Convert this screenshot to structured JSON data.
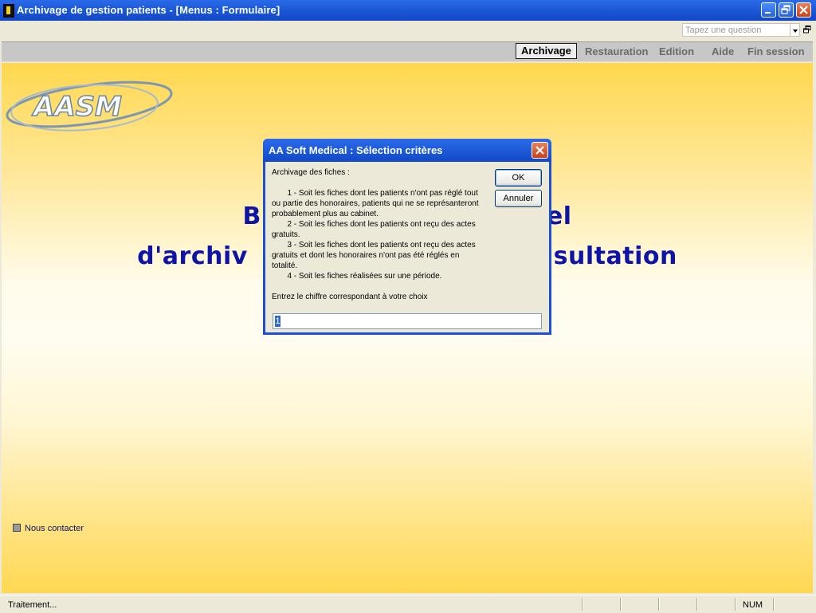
{
  "window": {
    "title": "Archivage de gestion patients - [Menus : Formulaire]"
  },
  "askbox": {
    "placeholder": "Tapez une question"
  },
  "menu": {
    "items": [
      {
        "label": "Archivage",
        "active": true
      },
      {
        "label": "Restauration",
        "active": false
      },
      {
        "label": "Edition",
        "active": false
      },
      {
        "label": "Aide",
        "active": false
      },
      {
        "label": "Fin session",
        "active": false
      }
    ]
  },
  "logo": {
    "text": "AASM"
  },
  "welcome": {
    "line1_left": "B",
    "line1_right": "el",
    "line2_left": "d'archiv",
    "line2_right": "nsultation"
  },
  "contact": {
    "label": "Nous contacter"
  },
  "dialog": {
    "title": "AA Soft Medical : Sélection critères",
    "message": "Archivage des fiches :\n\n       1 - Soit les fiches dont les patients n'ont pas réglé tout ou partie des honoraires, patients qui ne se représanteront probablement plus au cabinet.\n       2 - Soit les fiches dont les patients ont reçu des actes gratuits.\n       3 - Soit les fiches dont les patients ont reçu des actes gratuits et dont les honoraires n'ont pas été réglés en totalité.\n       4 - Soit les fiches réalisées sur une période.\n\nEntrez le chiffre correspondant à votre choix",
    "ok_label": "OK",
    "cancel_label": "Annuler",
    "input_value": "1"
  },
  "status": {
    "left": "Traitement...",
    "num": "NUM"
  },
  "colors": {
    "titlebar": "#1E5BD8",
    "welcome_text": "#0E14A6",
    "workspace_gold": "#FFD84E",
    "dialog_bg": "#ECE9D8"
  }
}
